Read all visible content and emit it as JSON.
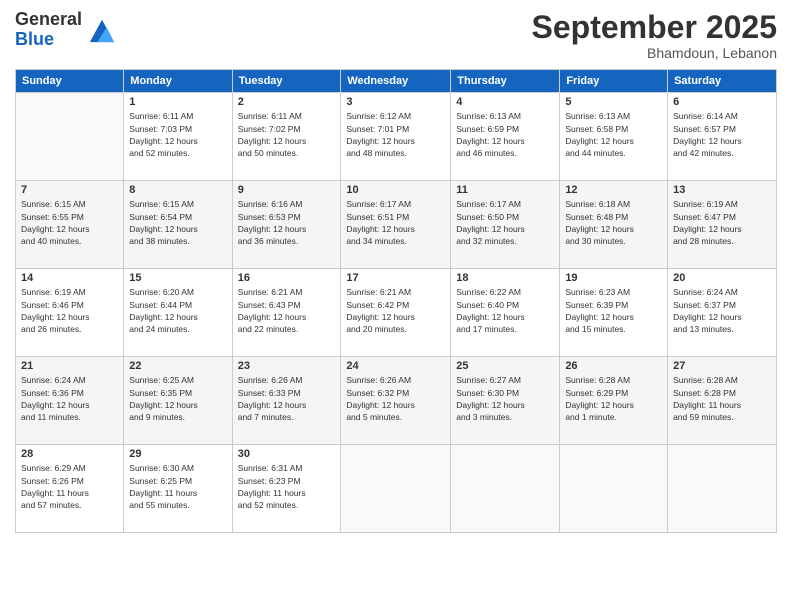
{
  "logo": {
    "general": "General",
    "blue": "Blue"
  },
  "header": {
    "month": "September 2025",
    "location": "Bhamdoun, Lebanon"
  },
  "days_of_week": [
    "Sunday",
    "Monday",
    "Tuesday",
    "Wednesday",
    "Thursday",
    "Friday",
    "Saturday"
  ],
  "weeks": [
    [
      {
        "day": "",
        "info": ""
      },
      {
        "day": "1",
        "info": "Sunrise: 6:11 AM\nSunset: 7:03 PM\nDaylight: 12 hours\nand 52 minutes."
      },
      {
        "day": "2",
        "info": "Sunrise: 6:11 AM\nSunset: 7:02 PM\nDaylight: 12 hours\nand 50 minutes."
      },
      {
        "day": "3",
        "info": "Sunrise: 6:12 AM\nSunset: 7:01 PM\nDaylight: 12 hours\nand 48 minutes."
      },
      {
        "day": "4",
        "info": "Sunrise: 6:13 AM\nSunset: 6:59 PM\nDaylight: 12 hours\nand 46 minutes."
      },
      {
        "day": "5",
        "info": "Sunrise: 6:13 AM\nSunset: 6:58 PM\nDaylight: 12 hours\nand 44 minutes."
      },
      {
        "day": "6",
        "info": "Sunrise: 6:14 AM\nSunset: 6:57 PM\nDaylight: 12 hours\nand 42 minutes."
      }
    ],
    [
      {
        "day": "7",
        "info": "Sunrise: 6:15 AM\nSunset: 6:55 PM\nDaylight: 12 hours\nand 40 minutes."
      },
      {
        "day": "8",
        "info": "Sunrise: 6:15 AM\nSunset: 6:54 PM\nDaylight: 12 hours\nand 38 minutes."
      },
      {
        "day": "9",
        "info": "Sunrise: 6:16 AM\nSunset: 6:53 PM\nDaylight: 12 hours\nand 36 minutes."
      },
      {
        "day": "10",
        "info": "Sunrise: 6:17 AM\nSunset: 6:51 PM\nDaylight: 12 hours\nand 34 minutes."
      },
      {
        "day": "11",
        "info": "Sunrise: 6:17 AM\nSunset: 6:50 PM\nDaylight: 12 hours\nand 32 minutes."
      },
      {
        "day": "12",
        "info": "Sunrise: 6:18 AM\nSunset: 6:48 PM\nDaylight: 12 hours\nand 30 minutes."
      },
      {
        "day": "13",
        "info": "Sunrise: 6:19 AM\nSunset: 6:47 PM\nDaylight: 12 hours\nand 28 minutes."
      }
    ],
    [
      {
        "day": "14",
        "info": "Sunrise: 6:19 AM\nSunset: 6:46 PM\nDaylight: 12 hours\nand 26 minutes."
      },
      {
        "day": "15",
        "info": "Sunrise: 6:20 AM\nSunset: 6:44 PM\nDaylight: 12 hours\nand 24 minutes."
      },
      {
        "day": "16",
        "info": "Sunrise: 6:21 AM\nSunset: 6:43 PM\nDaylight: 12 hours\nand 22 minutes."
      },
      {
        "day": "17",
        "info": "Sunrise: 6:21 AM\nSunset: 6:42 PM\nDaylight: 12 hours\nand 20 minutes."
      },
      {
        "day": "18",
        "info": "Sunrise: 6:22 AM\nSunset: 6:40 PM\nDaylight: 12 hours\nand 17 minutes."
      },
      {
        "day": "19",
        "info": "Sunrise: 6:23 AM\nSunset: 6:39 PM\nDaylight: 12 hours\nand 15 minutes."
      },
      {
        "day": "20",
        "info": "Sunrise: 6:24 AM\nSunset: 6:37 PM\nDaylight: 12 hours\nand 13 minutes."
      }
    ],
    [
      {
        "day": "21",
        "info": "Sunrise: 6:24 AM\nSunset: 6:36 PM\nDaylight: 12 hours\nand 11 minutes."
      },
      {
        "day": "22",
        "info": "Sunrise: 6:25 AM\nSunset: 6:35 PM\nDaylight: 12 hours\nand 9 minutes."
      },
      {
        "day": "23",
        "info": "Sunrise: 6:26 AM\nSunset: 6:33 PM\nDaylight: 12 hours\nand 7 minutes."
      },
      {
        "day": "24",
        "info": "Sunrise: 6:26 AM\nSunset: 6:32 PM\nDaylight: 12 hours\nand 5 minutes."
      },
      {
        "day": "25",
        "info": "Sunrise: 6:27 AM\nSunset: 6:30 PM\nDaylight: 12 hours\nand 3 minutes."
      },
      {
        "day": "26",
        "info": "Sunrise: 6:28 AM\nSunset: 6:29 PM\nDaylight: 12 hours\nand 1 minute."
      },
      {
        "day": "27",
        "info": "Sunrise: 6:28 AM\nSunset: 6:28 PM\nDaylight: 11 hours\nand 59 minutes."
      }
    ],
    [
      {
        "day": "28",
        "info": "Sunrise: 6:29 AM\nSunset: 6:26 PM\nDaylight: 11 hours\nand 57 minutes."
      },
      {
        "day": "29",
        "info": "Sunrise: 6:30 AM\nSunset: 6:25 PM\nDaylight: 11 hours\nand 55 minutes."
      },
      {
        "day": "30",
        "info": "Sunrise: 6:31 AM\nSunset: 6:23 PM\nDaylight: 11 hours\nand 52 minutes."
      },
      {
        "day": "",
        "info": ""
      },
      {
        "day": "",
        "info": ""
      },
      {
        "day": "",
        "info": ""
      },
      {
        "day": "",
        "info": ""
      }
    ]
  ]
}
